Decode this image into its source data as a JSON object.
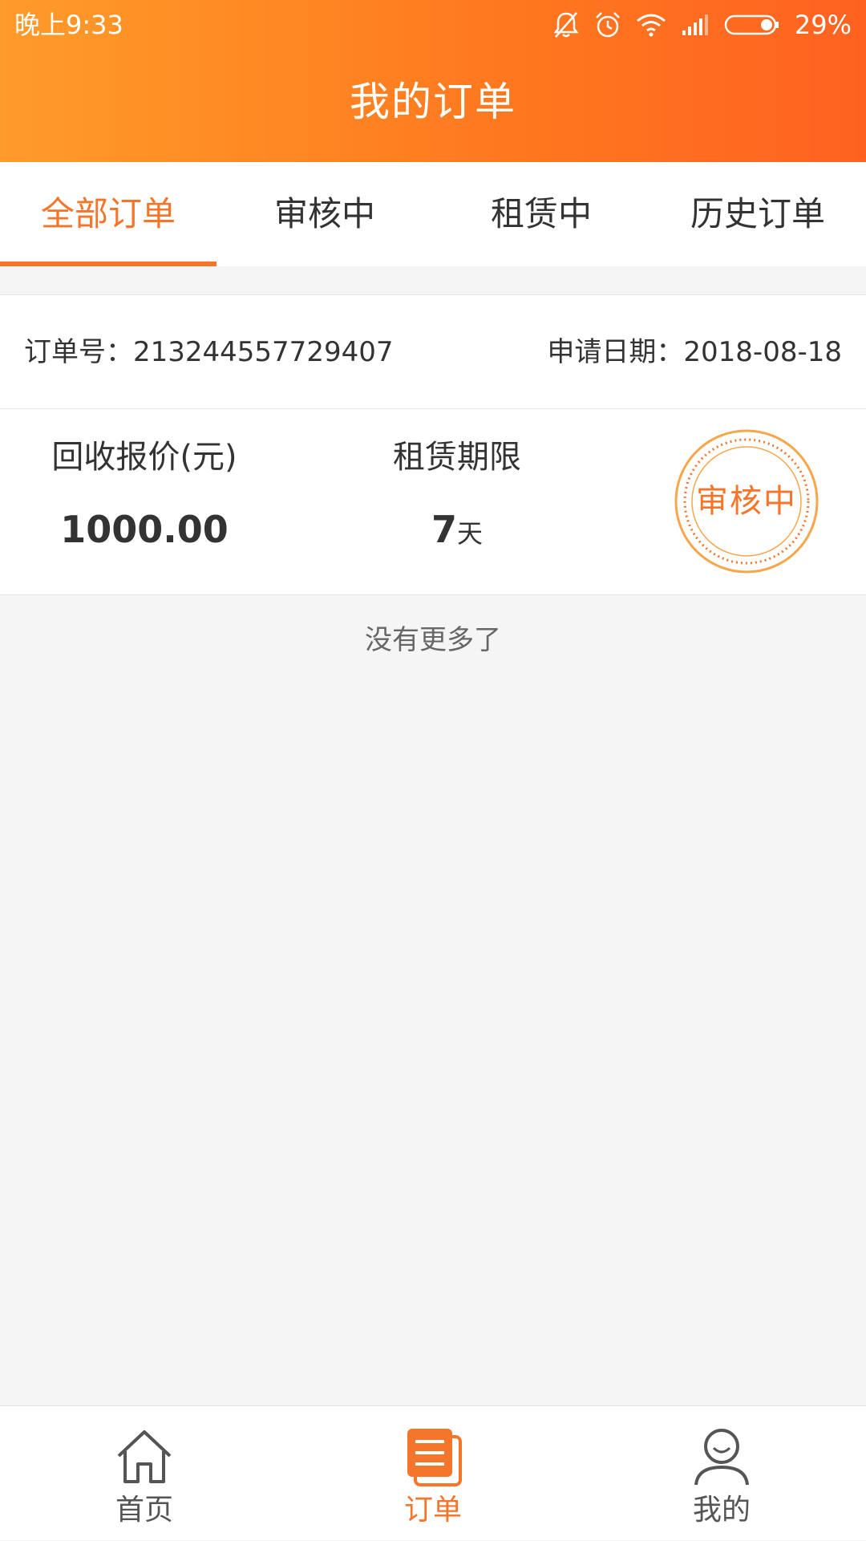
{
  "status_bar": {
    "time": "晚上9:33",
    "battery": "29%",
    "icons": [
      "bell-off-icon",
      "alarm-icon",
      "wifi-icon",
      "signal-icon",
      "battery-icon"
    ]
  },
  "header": {
    "title": "我的订单"
  },
  "tabs": [
    {
      "label": "全部订单",
      "active": true
    },
    {
      "label": "审核中",
      "active": false
    },
    {
      "label": "租赁中",
      "active": false
    },
    {
      "label": "历史订单",
      "active": false
    }
  ],
  "order": {
    "number": "订单号：213244557729407",
    "date": "申请日期：2018-08-18",
    "price_label": "回收报价(元)",
    "price_value": "1000.00",
    "term_label": "租赁期限",
    "term_value": "7",
    "term_unit": "天",
    "status_stamp": "审核中"
  },
  "footer_text": "没有更多了",
  "bottom_nav": [
    {
      "label": "首页",
      "icon": "home-icon",
      "active": false
    },
    {
      "label": "订单",
      "icon": "orders-icon",
      "active": true
    },
    {
      "label": "我的",
      "icon": "user-icon",
      "active": false
    }
  ],
  "colors": {
    "accent": "#f5752a",
    "header_start": "#ff9b2a",
    "header_end": "#ff6220",
    "background": "#f5f5f5"
  }
}
